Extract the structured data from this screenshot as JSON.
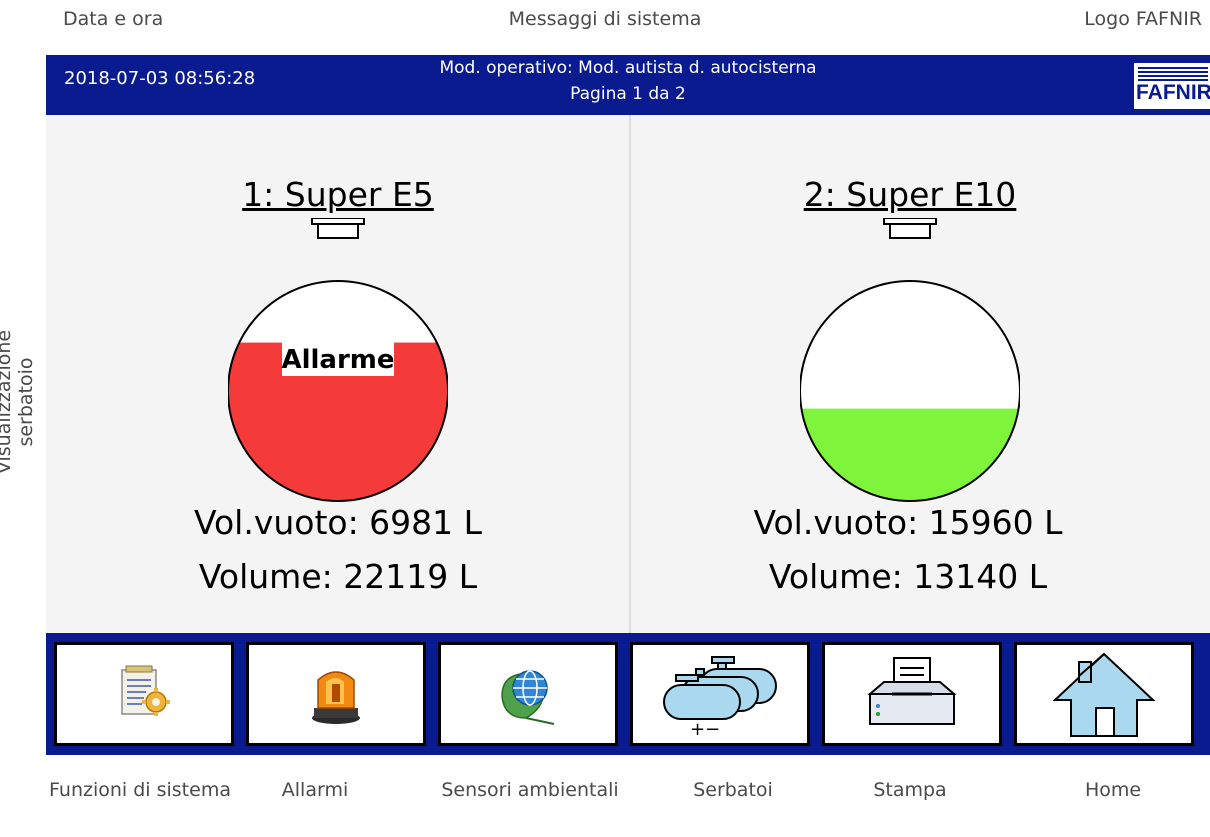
{
  "annotations": {
    "date_time": "Data e ora",
    "system_messages": "Messaggi di sistema",
    "logo": "Logo FAFNIR",
    "tank_visualization": "Visualizzazione serbatoio"
  },
  "header": {
    "datetime": "2018-07-03  08:56:28",
    "mode": "Mod. operativo: Mod. autista d. autocisterna",
    "page": "Pagina 1 da 2",
    "logo_text": "FAFNIR"
  },
  "tanks": [
    {
      "title": "1: Super E5",
      "fill_level": 0.72,
      "fill_color": "#f53a3a",
      "alarm_label": "Allarme",
      "ullage": "Vol.vuoto: 6981 L",
      "volume": "Volume: 22119 L"
    },
    {
      "title": "2: Super E10",
      "fill_level": 0.42,
      "fill_color": "#7ef53a",
      "alarm_label": "",
      "ullage": "Vol.vuoto: 15960 L",
      "volume": "Volume: 13140 L"
    }
  ],
  "toolbar": [
    {
      "icon": "system-functions-icon",
      "label": "Funzioni di sistema"
    },
    {
      "icon": "alarm-beacon-icon",
      "label": "Allarmi"
    },
    {
      "icon": "environmental-sensor-icon",
      "label": "Sensori ambientali"
    },
    {
      "icon": "tanks-icon",
      "label": "Serbatoi"
    },
    {
      "icon": "printer-icon",
      "label": "Stampa"
    },
    {
      "icon": "home-icon",
      "label": "Home"
    }
  ],
  "colors": {
    "header_bg": "#0a1b8f",
    "alarm": "#f53a3a",
    "ok": "#7ef53a"
  }
}
